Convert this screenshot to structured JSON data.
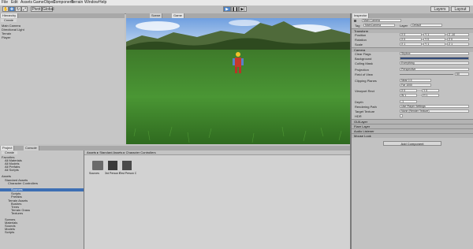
{
  "menu": [
    "File",
    "Edit",
    "Assets",
    "GameObject",
    "Component",
    "Terrain",
    "Window",
    "Help"
  ],
  "toolbar": {
    "tools": [
      "✋",
      "✥",
      "↻",
      "⤢"
    ],
    "pivot": "Pivot",
    "global": "Global",
    "play": "▶",
    "pause": "❚❚",
    "step": "▶|",
    "layers": "Layers",
    "layout": "Layout"
  },
  "hierarchy": {
    "tab": "Hierarchy",
    "create": "Create",
    "items": [
      "Main Camera",
      "Directional Light",
      "Terrain",
      "Player"
    ]
  },
  "scene_tabs": [
    "Scene",
    "Game"
  ],
  "game": {
    "aspect": "Free Aspect",
    "maximize": "Maximize on Play",
    "stats": "Stats",
    "gizmos": "Gizmos"
  },
  "inspector": {
    "tab": "Inspector",
    "object_name": "Main Camera",
    "tag_label": "Tag",
    "tag_value": "MainCamera",
    "layer_label": "Layer",
    "layer_value": "Default",
    "transform": "Transform",
    "position": "Position",
    "rotation": "Rotation",
    "scale": "Scale",
    "pos": [
      "X 0",
      "Y 1",
      "Z -10"
    ],
    "rot": [
      "X 0",
      "Y 0",
      "Z 0"
    ],
    "scl": [
      "X 1",
      "Y 1",
      "Z 1"
    ],
    "camera": "Camera",
    "clear_flags": "Clear Flags",
    "clear_flags_value": "Skybox",
    "background": "Background",
    "culling_mask": "Culling Mask",
    "culling_mask_value": "Everything",
    "projection": "Projection",
    "projection_value": "Perspective",
    "fov": "Field of View",
    "fov_value": "60",
    "clipping": "Clipping Planes",
    "near": "Near 0.3",
    "far": "Far 1000",
    "viewport": "Viewport Rect",
    "vp": [
      "X 0",
      "Y 0",
      "W 1",
      "H 1"
    ],
    "depth": "Depth",
    "depth_value": "-1",
    "rendering_path": "Rendering Path",
    "rendering_value": "Use Player Settings",
    "target_texture": "Target Texture",
    "target_value": "None (Render Texture)",
    "hdr": "HDR",
    "components": [
      "GUILayer",
      "Flare Layer",
      "Audio Listener",
      "Mouse Look"
    ],
    "add_component": "Add Component"
  },
  "project": {
    "tabs": [
      "Project",
      "Console"
    ],
    "create": "Create",
    "favorites": "Favorites",
    "fav_items": [
      "All Materials",
      "All Models",
      "All Prefabs",
      "All Scripts"
    ],
    "assets": "Assets",
    "tree": [
      "Standard Assets",
      "Character Controllers",
      "Sources",
      "Scripts",
      "Prefabs",
      "Terrain Assets",
      "Bushes",
      "Trees",
      "Terrain Grass",
      "Textures",
      "Scenes",
      "Materials",
      "Sounds",
      "Models",
      "Scripts"
    ],
    "breadcrumb": "Assets ▸ Standard Assets ▸ Character Controllers",
    "files": [
      "Sources",
      "3rd Person Controller",
      "First Person Controller"
    ]
  },
  "colors": {
    "sky": "#8fb4e6",
    "grass": "#3f8a2c",
    "selection": "#3d6fb4",
    "editor_bg": "#c2c2c2"
  }
}
